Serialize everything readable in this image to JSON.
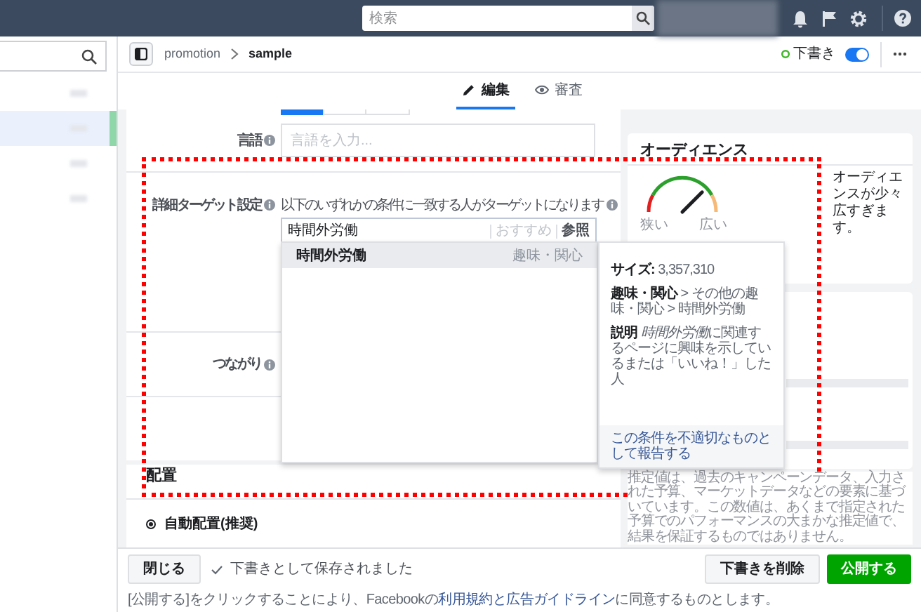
{
  "top_bar": {
    "search": {
      "placeholder": "検索"
    }
  },
  "sidebar": {
    "items": [
      {
        "selected": false
      },
      {
        "selected": true
      },
      {
        "selected": false
      },
      {
        "selected": false
      }
    ]
  },
  "header": {
    "breadcrumb": [
      "promotion",
      "sample"
    ],
    "status": "下書き",
    "draft_toggle": {
      "on": true
    }
  },
  "tabs": [
    {
      "label": "編集",
      "kind": "edit",
      "selected": true
    },
    {
      "label": "審査",
      "kind": "review",
      "selected": false
    }
  ],
  "form": {
    "language": {
      "label": "言語",
      "placeholder": "言語を入力..."
    },
    "detailed_targeting": {
      "label": "詳細ターゲット設定",
      "description": "以下のいずれかの条件に一致する人がターゲットになります",
      "value": "時間外労働",
      "suggest": "おすすめ",
      "browse": "参照"
    },
    "connections": {
      "label": "つながり"
    }
  },
  "placement": {
    "title": "配置",
    "options": [
      {
        "label": "自動配置(推奨)",
        "selected": true
      }
    ]
  },
  "dropdown": {
    "results": [
      {
        "name": "時間外労働",
        "category": "趣味・関心",
        "selected": true
      }
    ]
  },
  "detail": {
    "size": "**サイズ:** 3,357,310",
    "path": "**趣味・関心** > その他の趣味・関心 > 時間外労働",
    "description": {
      "label": "説明",
      "term": "時間外労働",
      "text": "に関連するページに興味を示しているまたは「いいね！」した人"
    },
    "report_link": "この条件を不適切なものとして報告する"
  },
  "audience": {
    "title": "オーディエンス",
    "level": 0.75,
    "low_label": "狭い",
    "high_label": "広い",
    "message": "オーディエンスが少々広すぎます。"
  },
  "estimate_note": "推定値は、過去のキャンペーンデータ、入力された予算、マーケットデータなどの要素に基づいています。この数値は、あくまで指定された予算でのパフォーマンスの大まかな推定値で、結果を保証するものではありません。",
  "footer": {
    "close": "閉じる",
    "saved": "下書きとして保存されました",
    "delete": "下書きを削除",
    "publish": "公開する",
    "legal": {
      "before": "[公開する]をクリックすることにより、Facebookの",
      "link": "利用規約と広告ガイドライン",
      "after": "に同意するものとします。"
    }
  }
}
